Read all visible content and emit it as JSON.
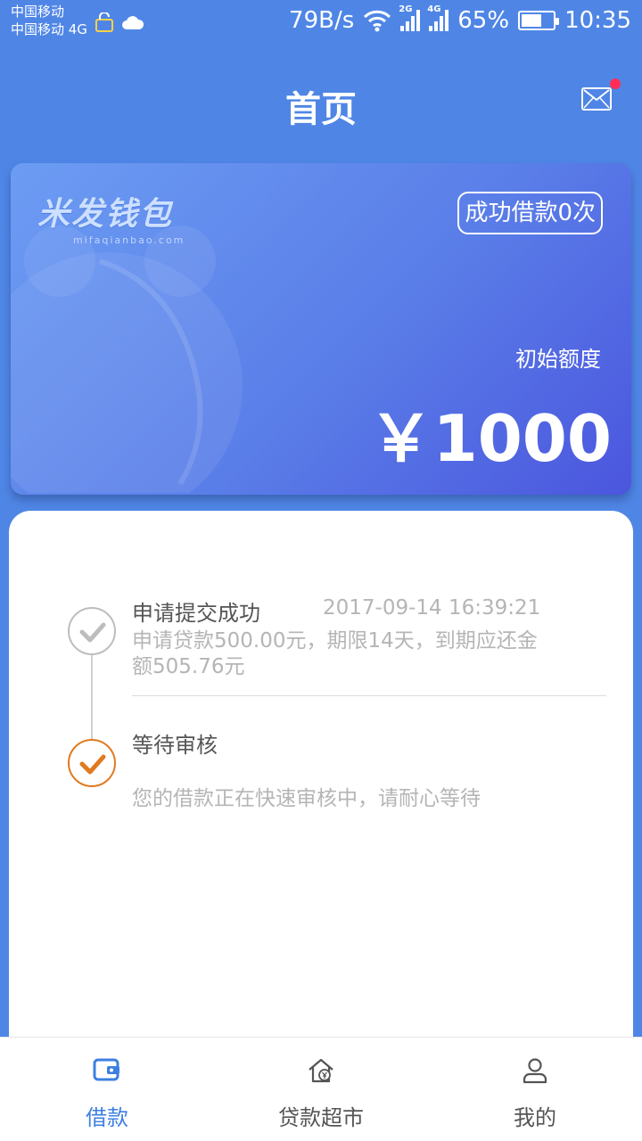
{
  "status_bar": {
    "carrier_1": "中国移动",
    "carrier_2": "中国移动 4G",
    "net_speed": "79B/s",
    "sig1_label": "2G",
    "sig2_label": "4G",
    "battery_percent": "65%",
    "battery_level": 0.65,
    "time": "10:35"
  },
  "header": {
    "title": "首页"
  },
  "card": {
    "logo_text": "米发钱包",
    "logo_sub": "mifaqianbao.com",
    "success_badge": "成功借款0次",
    "quota_label": "初始额度",
    "amount": "￥1000"
  },
  "timeline": {
    "steps": [
      {
        "title": "申请提交成功",
        "time": "2017-09-14 16:39:21",
        "desc": "申请贷款500.00元，期限14天，到期应还金额505.76元"
      },
      {
        "title": "等待审核",
        "desc": "您的借款正在快速审核中，请耐心等待"
      }
    ]
  },
  "tabs": [
    {
      "label": "借款"
    },
    {
      "label": "贷款超市"
    },
    {
      "label": "我的"
    }
  ],
  "colors": {
    "primary": "#4f86e6",
    "accent_orange": "#e07a1f",
    "badge_red": "#ff2d55"
  }
}
